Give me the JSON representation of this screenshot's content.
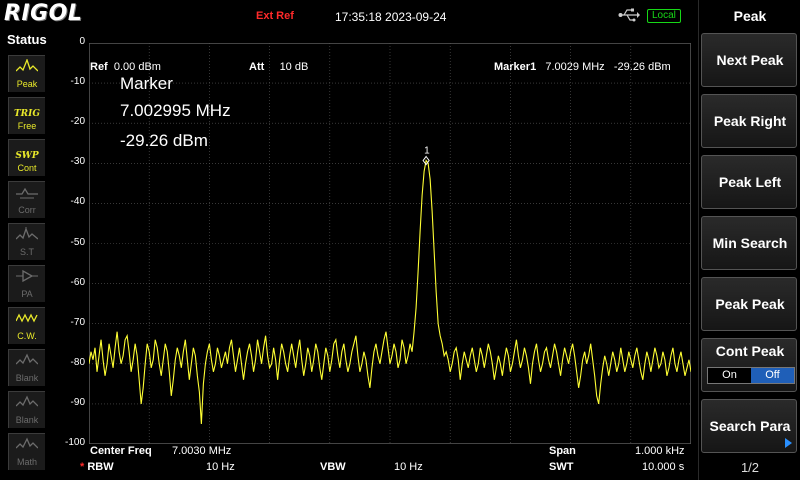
{
  "brand": "RIGOL",
  "top_bar": {
    "ext_ref": "Ext Ref",
    "datetime": "17:35:18 2023-09-24",
    "local_label": "Local"
  },
  "status_panel": {
    "title": "Status",
    "items": [
      {
        "label": "Peak",
        "state": "on"
      },
      {
        "label_top": "TRIG",
        "label": "Free",
        "state": "on"
      },
      {
        "label_top": "SWP",
        "label": "Cont",
        "state": "on"
      },
      {
        "label": "Corr",
        "state": "off"
      },
      {
        "label": "S.T",
        "state": "off"
      },
      {
        "label": "PA",
        "state": "off"
      },
      {
        "label": "C.W.",
        "state": "on"
      },
      {
        "label": "Blank",
        "state": "off"
      },
      {
        "label": "Blank",
        "state": "off"
      },
      {
        "label": "Math",
        "state": "off"
      }
    ]
  },
  "header": {
    "ref_label": "Ref",
    "ref_value": "0.00 dBm",
    "att_label": "Att",
    "att_value": "10 dB",
    "marker_label": "Marker1",
    "marker_freq": "7.0029 MHz",
    "marker_amp": "-29.26 dBm"
  },
  "marker_readout": {
    "title": "Marker",
    "freq": "7.002995 MHz",
    "amp": "-29.26 dBm",
    "tag": "1"
  },
  "y_ticks": [
    "0",
    "-10",
    "-20",
    "-30",
    "-40",
    "-50",
    "-60",
    "-70",
    "-80",
    "-90",
    "-100"
  ],
  "footer": {
    "center_label": "Center Freq",
    "center_value": "7.0030 MHz",
    "span_label": "Span",
    "span_value": "1.000 kHz",
    "rbw_star": "*",
    "rbw_label": "RBW",
    "rbw_value": "10 Hz",
    "vbw_label": "VBW",
    "vbw_value": "10 Hz",
    "swt_label": "SWT",
    "swt_value": "10.000 s"
  },
  "menu": {
    "title": "Peak",
    "keys": [
      "Next Peak",
      "Peak Right",
      "Peak Left",
      "Min Search",
      "Peak Peak"
    ],
    "cont_peak": {
      "label": "Cont Peak",
      "on": "On",
      "off": "Off"
    },
    "search_para": "Search Para",
    "page": "1/2"
  },
  "colors": {
    "trace": "#ffff33",
    "grid": "#5a5a5a",
    "status_on": "#e9e92a",
    "accent": "#1f5fb8"
  },
  "chart_data": {
    "type": "line",
    "xlabel": "",
    "ylabel": "",
    "ylim": [
      -100,
      0
    ],
    "xlim": [
      6.9955,
      7.0005
    ],
    "x_unit": "MHz",
    "series": [
      {
        "values": [
          -80,
          -77,
          -79,
          -76,
          -82,
          -78,
          -74,
          -79,
          -83,
          -80,
          -75,
          -78,
          -81,
          -76,
          -72,
          -77,
          -80,
          -78,
          -74,
          -73,
          -77,
          -82,
          -79,
          -75,
          -78,
          -84,
          -90,
          -86,
          -80,
          -75,
          -77,
          -81,
          -79,
          -74,
          -76,
          -80,
          -83,
          -79,
          -75,
          -77,
          -82,
          -88,
          -84,
          -79,
          -76,
          -78,
          -81,
          -77,
          -74,
          -79,
          -84,
          -80,
          -76,
          -78,
          -83,
          -87,
          -95,
          -85,
          -80,
          -77,
          -75,
          -79,
          -82,
          -80,
          -76,
          -78,
          -81,
          -79,
          -77,
          -80,
          -76,
          -74,
          -78,
          -82,
          -79,
          -76,
          -80,
          -84,
          -80,
          -77,
          -75,
          -78,
          -82,
          -79,
          -74,
          -77,
          -80,
          -76,
          -73,
          -78,
          -81,
          -80,
          -76,
          -79,
          -84,
          -79,
          -75,
          -77,
          -80,
          -82,
          -78,
          -75,
          -78,
          -81,
          -77,
          -74,
          -79,
          -83,
          -80,
          -76,
          -78,
          -82,
          -79,
          -75,
          -77,
          -81,
          -84,
          -80,
          -76,
          -78,
          -82,
          -79,
          -75,
          -74,
          -78,
          -81,
          -77,
          -75,
          -79,
          -82,
          -80,
          -77,
          -75,
          -73,
          -78,
          -82,
          -80,
          -77,
          -79,
          -83,
          -86,
          -81,
          -77,
          -75,
          -78,
          -80,
          -77,
          -74,
          -72,
          -76,
          -80,
          -78,
          -75,
          -77,
          -81,
          -79,
          -74,
          -76,
          -80,
          -78,
          -75,
          -77,
          -72,
          -66,
          -57,
          -47,
          -38,
          -32,
          -29.3,
          -30,
          -34,
          -42,
          -52,
          -62,
          -70,
          -73,
          -75,
          -78,
          -77,
          -79,
          -82,
          -80,
          -77,
          -76,
          -79,
          -84,
          -80,
          -77,
          -79,
          -81,
          -78,
          -76,
          -79,
          -82,
          -80,
          -76,
          -78,
          -81,
          -78,
          -75,
          -77,
          -80,
          -84,
          -81,
          -78,
          -80,
          -83,
          -79,
          -76,
          -78,
          -82,
          -80,
          -77,
          -74,
          -78,
          -81,
          -79,
          -76,
          -78,
          -81,
          -85,
          -80,
          -77,
          -75,
          -79,
          -82,
          -80,
          -77,
          -76,
          -79,
          -81,
          -78,
          -75,
          -77,
          -80,
          -83,
          -79,
          -76,
          -78,
          -80,
          -77,
          -75,
          -78,
          -82,
          -86,
          -83,
          -79,
          -77,
          -80,
          -78,
          -75,
          -79,
          -83,
          -88,
          -90,
          -85,
          -81,
          -78,
          -80,
          -83,
          -80,
          -77,
          -79,
          -82,
          -80,
          -76,
          -79,
          -82,
          -80,
          -77,
          -79,
          -81,
          -78,
          -76,
          -79,
          -82,
          -84,
          -80,
          -77,
          -79,
          -82,
          -79,
          -76,
          -78,
          -81,
          -80,
          -77,
          -79,
          -83,
          -81,
          -78,
          -76,
          -80,
          -82,
          -79,
          -77,
          -80,
          -83,
          -81,
          -79,
          -82
        ]
      }
    ],
    "marker": {
      "index": 168,
      "freq_mhz": 7.002995,
      "amp_dbm": -29.26,
      "label": "1"
    }
  }
}
